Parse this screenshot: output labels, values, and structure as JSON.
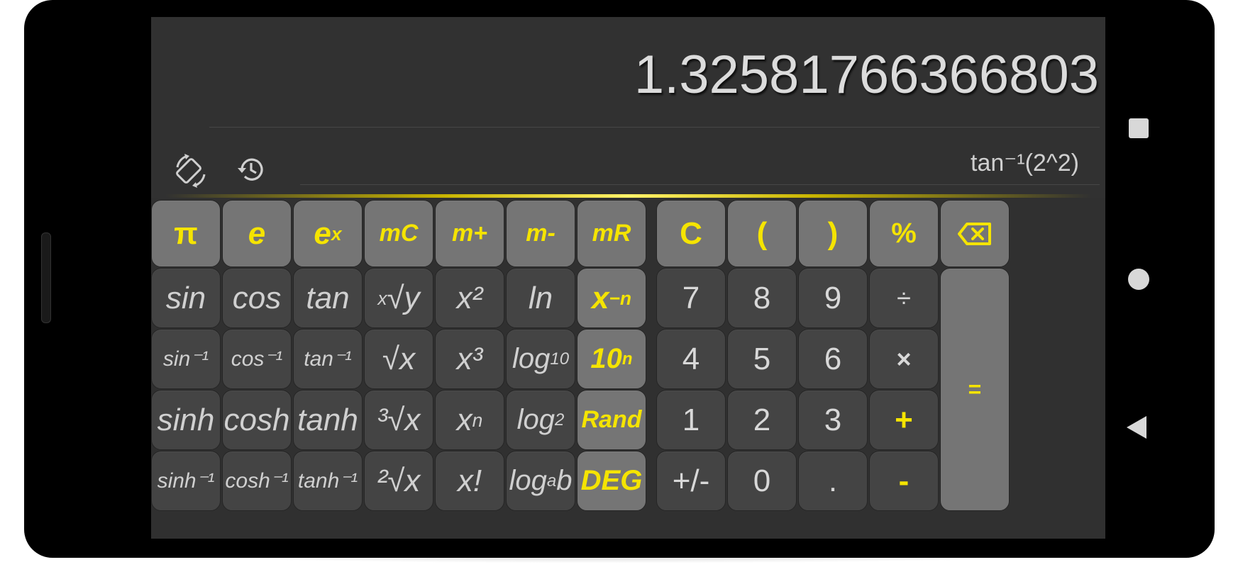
{
  "display": {
    "result": "1.32581766366803",
    "expression": "tan⁻¹(2^2)"
  },
  "toolbar": {
    "rotate_icon": "screen-rotation-icon",
    "history_icon": "history-icon"
  },
  "keys": {
    "pi": "π",
    "e": "e",
    "ex_base": "e",
    "ex_sup": "x",
    "mc": "mC",
    "mplus": "m+",
    "mminus": "m-",
    "mr": "mR",
    "clear": "C",
    "lparen": "(",
    "rparen": ")",
    "percent": "%",
    "sin": "sin",
    "cos": "cos",
    "tan": "tan",
    "xrooty_sup": "x",
    "xrooty_body": "√y",
    "x2": "x²",
    "ln": "ln",
    "xneg_base": "x",
    "xneg_sup": "−n",
    "asin": "sin⁻¹",
    "acos": "cos⁻¹",
    "atan": "tan⁻¹",
    "sqrt": "√x",
    "x3": "x³",
    "log10_base": "log",
    "log10_sub": "10",
    "ten_base": "10",
    "ten_sup": "n",
    "sinh": "sinh",
    "cosh": "cosh",
    "tanh": "tanh",
    "cbrt": "³√x",
    "xn_base": "x",
    "xn_sup": "n",
    "log2_base": "log",
    "log2_sub": "2",
    "rand": "Rand",
    "asinh": "sinh⁻¹",
    "acosh": "cosh⁻¹",
    "atanh": "tanh⁻¹",
    "sqrt2": "²√x",
    "fact": "x!",
    "logab_base": "log",
    "logab_sub": "a",
    "logab_b": "b",
    "deg": "DEG",
    "n7": "7",
    "n8": "8",
    "n9": "9",
    "divide": "÷",
    "n4": "4",
    "n5": "5",
    "n6": "6",
    "multiply": "×",
    "n1": "1",
    "n2": "2",
    "n3": "3",
    "plus": "+",
    "plusminus": "+/-",
    "n0": "0",
    "dot": ".",
    "minus": "-",
    "equals": "="
  },
  "colors": {
    "accent": "#f5e400",
    "key_dark": "#444444",
    "key_light": "#757575",
    "screen_bg": "#303030"
  }
}
